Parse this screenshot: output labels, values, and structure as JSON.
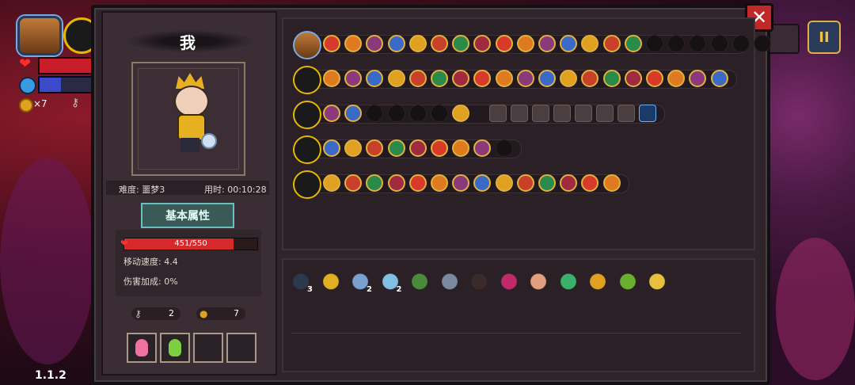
{
  "hud": {
    "coins": "×7",
    "version": "1.1.2",
    "pause_label": "II"
  },
  "panel": {
    "close_label": "✕"
  },
  "character": {
    "name": "我",
    "difficulty": "难度: 噩梦3",
    "time": "用时: 00:10:28",
    "attr_button": "基本属性",
    "hp": "451/550",
    "hp_fraction": 0.82,
    "speed": "移动速度: 4.4",
    "damage_bonus": "伤害加成: 0%",
    "keys": "2",
    "coins": "7",
    "potions": [
      "pink-potion",
      "green-potion",
      "",
      ""
    ]
  },
  "rows": [
    {
      "name": "chest-row",
      "icon": "treasure-chest-icon",
      "orbs": 15,
      "empty": 6
    },
    {
      "name": "weapon-row-1",
      "icon": "green-staff-icon",
      "orbs": 19,
      "empty": 0
    },
    {
      "name": "weapon-row-2",
      "icon": "dark-staff-icon",
      "orbs": 2,
      "empty": 4,
      "extra_orbs": 1,
      "squares": 8
    },
    {
      "name": "weapon-row-3",
      "icon": "gold-staff-icon",
      "orbs": 8,
      "empty": 1
    },
    {
      "name": "armor-row",
      "icon": "gauntlet-icon",
      "orbs": 14,
      "empty": 0
    }
  ],
  "items": [
    {
      "name": "dark-cloak-icon",
      "count": "3"
    },
    {
      "name": "trident-icon",
      "count": ""
    },
    {
      "name": "magnifier-icon",
      "count": "2"
    },
    {
      "name": "blue-boots-icon",
      "count": "2"
    },
    {
      "name": "green-helmet-icon",
      "count": ""
    },
    {
      "name": "gauntlet-icon",
      "count": ""
    },
    {
      "name": "dark-armor-icon",
      "count": ""
    },
    {
      "name": "rainbow-cape-icon",
      "count": ""
    },
    {
      "name": "pink-shield-icon",
      "count": ""
    },
    {
      "name": "leaf-icon",
      "count": ""
    },
    {
      "name": "gold-wing-icon",
      "count": ""
    },
    {
      "name": "green-orb-icon",
      "count": ""
    },
    {
      "name": "gold-flame-icon",
      "count": ""
    }
  ],
  "colors": {
    "orb_gold": "#e0b040",
    "orb_red": "#d83a2a",
    "panel": "#2e2429"
  }
}
